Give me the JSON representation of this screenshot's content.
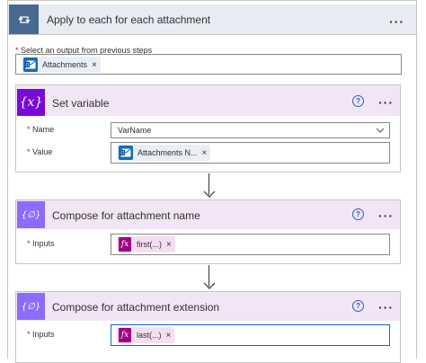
{
  "loop": {
    "title": "Apply to each for each attachment",
    "select_label": "Select an output from previous steps",
    "token_label": "Attachments",
    "remove_glyph": "×",
    "more_glyph": "···"
  },
  "set_variable": {
    "title": "Set variable",
    "name_label": "Name",
    "name_value": "VarName",
    "value_label": "Value",
    "value_token": "Attachments N...",
    "remove_glyph": "×",
    "help_glyph": "?",
    "more_glyph": "···",
    "icon_glyph": "{x}"
  },
  "compose_name": {
    "title": "Compose for attachment name",
    "inputs_label": "Inputs",
    "token": "first(...)",
    "token_icon": "fx",
    "remove_glyph": "×",
    "help_glyph": "?",
    "more_glyph": "···",
    "icon_glyph": "{∅}"
  },
  "compose_ext": {
    "title": "Compose for attachment extension",
    "inputs_label": "Inputs",
    "token": "last(...)",
    "token_icon": "fx",
    "remove_glyph": "×",
    "help_glyph": "?",
    "more_glyph": "···",
    "icon_glyph": "{∅}"
  },
  "required_marker": "*",
  "colors": {
    "loop_header": "#e8ebf2",
    "loop_icon": "#486991",
    "variable_icon": "#770bd6",
    "compose_icon": "#8c6cff",
    "card_header": "#f0e6f6",
    "focus_border": "#0f6cbd"
  }
}
